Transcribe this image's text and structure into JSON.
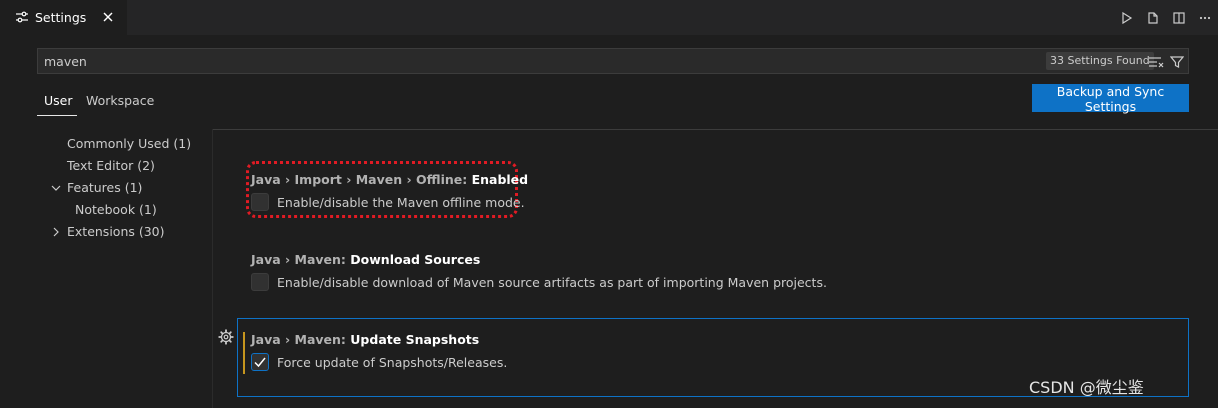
{
  "tab": {
    "label": "Settings",
    "icon": "settings-sliders-icon"
  },
  "editor_actions": [
    "run-icon",
    "open-json-icon",
    "split-editor-icon",
    "more-actions-icon"
  ],
  "search": {
    "value": "maven",
    "results_badge": "33 Settings Found"
  },
  "scopes": {
    "user": "User",
    "workspace": "Workspace"
  },
  "sync_button": "Backup and Sync Settings",
  "toc": [
    {
      "label": "Commonly Used (1)"
    },
    {
      "label": "Text Editor (2)"
    },
    {
      "label": "Features (1)",
      "expanded": true
    },
    {
      "label": "Notebook (1)"
    },
    {
      "label": "Extensions (30)",
      "expanded": false
    }
  ],
  "settings": [
    {
      "category": "Java › Import › Maven › Offline: ",
      "key": "Enabled",
      "description": "Enable/disable the Maven offline mode.",
      "checked": false
    },
    {
      "category": "Java › Maven: ",
      "key": "Download Sources",
      "description": "Enable/disable download of Maven source artifacts as part of importing Maven projects.",
      "checked": false
    },
    {
      "category": "Java › Maven: ",
      "key": "Update Snapshots",
      "description": "Force update of Snapshots/Releases.",
      "checked": true
    }
  ],
  "watermark": "CSDN @微尘鉴",
  "colors": {
    "accent": "#0e72c6",
    "highlight_annotation": "#e01b24",
    "modified_indicator": "#c6961e"
  }
}
